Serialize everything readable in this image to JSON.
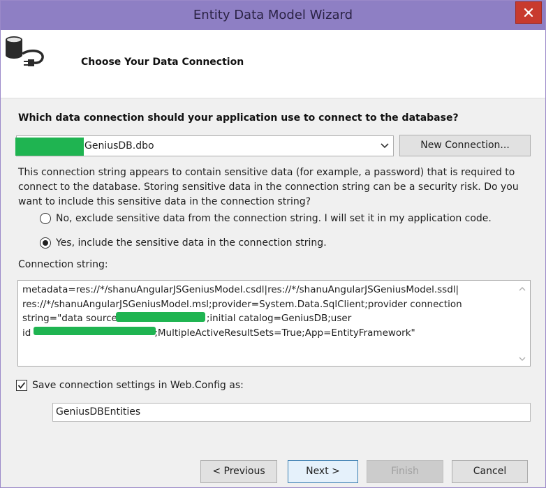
{
  "window": {
    "title": "Entity Data Model Wizard",
    "close_glyph": "✕"
  },
  "header": {
    "title": "Choose Your Data Connection",
    "icon": "database-plug-icon"
  },
  "question": "Which data connection should your application use to connect to the database?",
  "connection_combo": {
    "selected_value": "GeniusDB.dbo"
  },
  "new_connection_label": "New Connection...",
  "warning_text": "This connection string appears to contain sensitive data (for example, a password) that is required to connect to the database. Storing sensitive data in the connection string can be a security risk. Do you want to include this sensitive data in the connection string?",
  "radios": [
    {
      "label": "No, exclude sensitive data from the connection string. I will set it in my application code.",
      "checked": false
    },
    {
      "label": "Yes, include the sensitive data in the connection string.",
      "checked": true
    }
  ],
  "connection_string_label": "Connection string:",
  "connection_string": {
    "line1": "metadata=res://*/shanuAngularJSGeniusModel.csdl|res://*/shanuAngularJSGeniusModel.ssdl|",
    "line2": "res://*/shanuAngularJSGeniusModel.msl;provider=System.Data.SqlClient;provider connection",
    "line3_start": "string=\"data source",
    "line3_end": ";initial catalog=GeniusDB;user",
    "line4_start": "id",
    "line4_end": ";MultipleActiveResultSets=True;App=EntityFramework\""
  },
  "save_settings": {
    "label": "Save connection settings in Web.Config as:",
    "checked": true,
    "value": "GeniusDBEntities"
  },
  "buttons": {
    "previous": "< Previous",
    "next": "Next >",
    "finish": "Finish",
    "cancel": "Cancel"
  },
  "colors": {
    "titlebar": "#8e7fc4",
    "close": "#c83a2e",
    "redaction": "#1fb451"
  }
}
